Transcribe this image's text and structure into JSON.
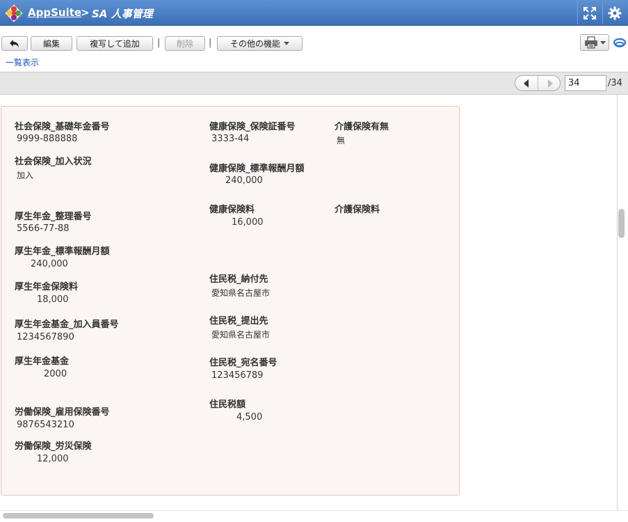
{
  "header": {
    "app_name": "AppSuite",
    "separator": ">",
    "current_app": "SA 人事管理"
  },
  "toolbar": {
    "edit_label": "編集",
    "copy_add_label": "複写して追加",
    "divider": "|",
    "delete_label": "削除",
    "more_label": "その他の機能",
    "list_view_link": "一覧表示"
  },
  "pager": {
    "current_page": "34",
    "total_pages": "/34"
  },
  "record": {
    "social_basic_pension_no": {
      "label": "社会保険_基礎年金番号",
      "value": "9999-888888"
    },
    "social_enrollment": {
      "label": "社会保険_加入状況",
      "value": "加入"
    },
    "kosei_ref_no": {
      "label": "厚生年金_整理番号",
      "value": "5566-77-88"
    },
    "kosei_std_monthly": {
      "label": "厚生年金_標準報酬月額",
      "value": "240,000"
    },
    "kosei_premium": {
      "label": "厚生年金保険料",
      "value": "18,000"
    },
    "kosei_fund_member_no": {
      "label": "厚生年金基金_加入員番号",
      "value": "1234567890"
    },
    "kosei_fund": {
      "label": "厚生年金基金",
      "value": "2000"
    },
    "labor_employment_no": {
      "label": "労働保険_雇用保険番号",
      "value": "9876543210"
    },
    "labor_accident": {
      "label": "労働保険_労災保険",
      "value": "12,000"
    },
    "health_cert_no": {
      "label": "健康保険_保険証番号",
      "value": "3333-44"
    },
    "health_std_monthly": {
      "label": "健康保険_標準報酬月額",
      "value": "240,000"
    },
    "health_premium": {
      "label": "健康保険料",
      "value": "16,000"
    },
    "resident_pay_to": {
      "label": "住民税_納付先",
      "value": "愛知県名古屋市"
    },
    "resident_submit_to": {
      "label": "住民税_提出先",
      "value": "愛知県名古屋市"
    },
    "resident_addressee_no": {
      "label": "住民税_宛名番号",
      "value": "123456789"
    },
    "resident_tax_amount": {
      "label": "住民税額",
      "value": "4,500"
    },
    "care_insurance_flag": {
      "label": "介護保険有無",
      "value": "無"
    },
    "care_insurance_premium": {
      "label": "介護保険料",
      "value": ""
    }
  },
  "colors": {
    "titlebar": "#4a80c6",
    "panel_bg": "#fbf6f4",
    "panel_border": "#e5c5bd",
    "link": "#1a4ec4"
  }
}
